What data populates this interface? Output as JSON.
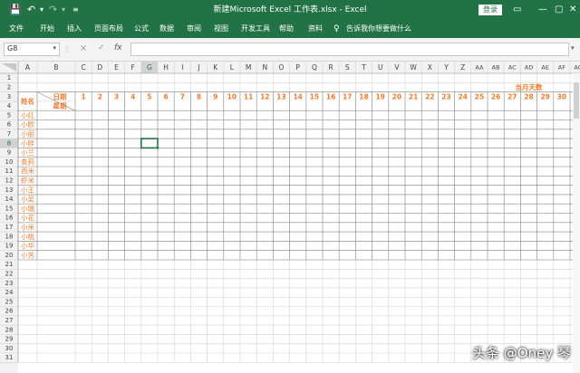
{
  "window": {
    "title": "新建Microsoft Excel 工作表.xlsx  -  Excel",
    "signin": "登录",
    "icons": {
      "save": "save-icon",
      "undo": "undo-icon",
      "redo": "redo-icon",
      "customize": "customize-qat-icon",
      "ribbon_display": "ribbon-display-options-icon",
      "minimize": "minimize-icon",
      "maximize": "maximize-icon",
      "close": "close-icon"
    }
  },
  "ribbon": {
    "tabs": [
      "文件",
      "开始",
      "插入",
      "页面布局",
      "公式",
      "数据",
      "审阅",
      "视图",
      "开发工具",
      "帮助",
      "资料"
    ],
    "tell_me": "告诉我你想要做什么"
  },
  "formula_bar": {
    "name_box": "G8",
    "cancel": "×",
    "enter": "✓",
    "fx": "fx",
    "value": ""
  },
  "sheet": {
    "columns": [
      "A",
      "B",
      "C",
      "D",
      "E",
      "F",
      "G",
      "H",
      "I",
      "J",
      "K",
      "L",
      "M",
      "N",
      "O",
      "P",
      "Q",
      "R",
      "S",
      "T",
      "U",
      "V",
      "W",
      "X",
      "Y",
      "Z",
      "AA",
      "AB",
      "AC",
      "AD",
      "AE",
      "AF",
      "AG"
    ],
    "row_count": 31,
    "selected_cell": "G8",
    "selected_col": "G",
    "selected_row": 8,
    "text_color": "#ed7d31",
    "cells": {
      "month_days_label": "当月天数",
      "month_days_value": "31",
      "date_label": "日期",
      "weekday_label": "星期",
      "name_header": "姓名",
      "days": [
        "1",
        "2",
        "3",
        "4",
        "5",
        "6",
        "7",
        "8",
        "9",
        "10",
        "11",
        "12",
        "13",
        "14",
        "15",
        "16",
        "17",
        "18",
        "19",
        "20",
        "21",
        "22",
        "23",
        "24",
        "25",
        "26",
        "27",
        "28",
        "29",
        "30",
        "31"
      ],
      "names": [
        "小红",
        "小欧",
        "小丽",
        "小胖",
        "小兰",
        "查莉",
        "西米",
        "虾米",
        "小王",
        "小吴",
        "小瑞",
        "小花",
        "小米",
        "小桃",
        "小华",
        "小芳"
      ]
    }
  },
  "watermark": "头条 @Oney 琴"
}
